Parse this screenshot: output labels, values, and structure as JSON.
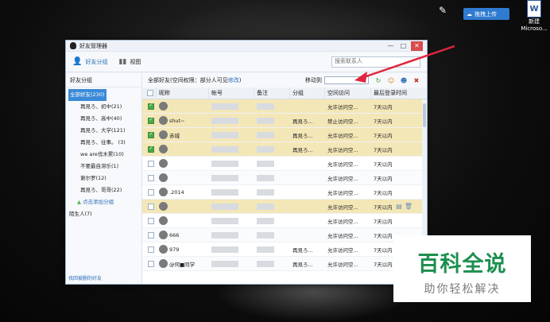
{
  "desktop": {
    "upload_label": "拖拽上传",
    "word_icon_label1": "新建",
    "word_icon_label2": "Microso..."
  },
  "window": {
    "title": "好友管理器",
    "minimize": "—",
    "maximize": "□",
    "close": "✕"
  },
  "toolbar": {
    "friend_group": "好友分组",
    "view": "视图",
    "search_placeholder": "搜索联系人"
  },
  "sidebar": {
    "header": "好友分组",
    "groups": [
      {
        "label": "全部好友(230)",
        "selected": true
      },
      {
        "label": "再見ろ、初中(21)"
      },
      {
        "label": "再見ろ、高中(40)"
      },
      {
        "label": "再見ろ、大学(121)"
      },
      {
        "label": "再見ろ、往事。  (3)"
      },
      {
        "label": "we are伐木累(10)"
      },
      {
        "label": "不要最自滞乐(1)"
      },
      {
        "label": "谢尔罗(12)"
      },
      {
        "label": "再見ろ、哥哥(22)"
      },
      {
        "label": "点击添加分组"
      },
      {
        "label": "陌生人(7)"
      }
    ],
    "footer": "找回被删的好友"
  },
  "main": {
    "title_prefix": "全部好友(空间权限：部分人可见",
    "title_link": "修改",
    "title_suffix": ")",
    "move_to": "移动到",
    "columns": [
      "",
      "昵称",
      "帐号",
      "备注",
      "分组",
      "空间访问",
      "最后登录时间"
    ],
    "rows": [
      {
        "nick": "",
        "group": "",
        "access": "允许访问空...",
        "last": "7天以内",
        "sel": true
      },
      {
        "nick": "shut~",
        "group": "再見ろ...",
        "access": "禁止访问空...",
        "last": "7天以内",
        "sel": true
      },
      {
        "nick": "赤城",
        "group": "再見ろ...",
        "access": "允许访问空...",
        "last": "7天以内",
        "sel": true
      },
      {
        "nick": "",
        "group": "再見ろ...",
        "access": "允许访问空...",
        "last": "7天以内",
        "sel": true
      },
      {
        "nick": "",
        "group": "",
        "access": "允许访问空...",
        "last": "7天以内"
      },
      {
        "nick": "",
        "group": "",
        "access": "允许访问空...",
        "last": "7天以内"
      },
      {
        "nick": ".2014",
        "group": "",
        "access": "允许访问空...",
        "last": "7天以内"
      },
      {
        "nick": "",
        "group": "",
        "access": "允许访问空...",
        "last": "7天以内",
        "sel": true,
        "icons": true
      },
      {
        "nick": "",
        "group": "",
        "access": "允许访问空...",
        "last": "7天以内"
      },
      {
        "nick": "666",
        "group": "",
        "access": "允许访问空...",
        "last": "7天以内"
      },
      {
        "nick": "979",
        "group": "再見ろ...",
        "access": "允许访问空...",
        "last": "7天以内"
      },
      {
        "nick": "@何■同学",
        "group": "再見ろ...",
        "access": "允许访问空...",
        "last": "7天以内"
      }
    ]
  },
  "watermark": {
    "big": "百科全说",
    "small": "助你轻松解决"
  }
}
